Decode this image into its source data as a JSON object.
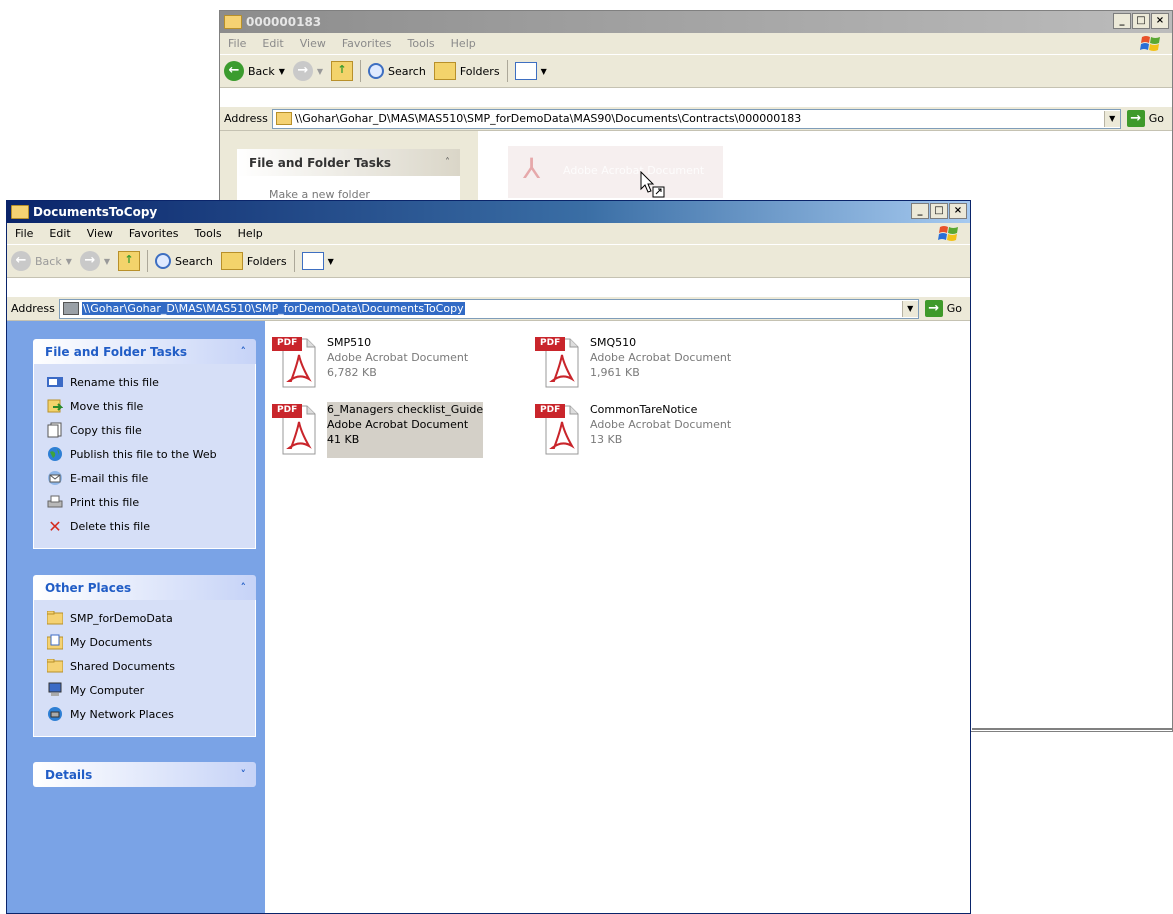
{
  "back_window": {
    "title": "000000183",
    "menu": [
      "File",
      "Edit",
      "View",
      "Favorites",
      "Tools",
      "Help"
    ],
    "toolbar": {
      "back": "Back",
      "search": "Search",
      "folders": "Folders"
    },
    "address_label": "Address",
    "address": "\\\\Gohar\\Gohar_D\\MAS\\MAS510\\SMP_forDemoData\\MAS90\\Documents\\Contracts\\000000183",
    "go": "Go",
    "task_title": "File and Folder Tasks",
    "task_first": "Make a new folder",
    "ghost_file": {
      "type": "Adobe Acrobat Document"
    }
  },
  "front_window": {
    "title": "DocumentsToCopy",
    "menu": [
      "File",
      "Edit",
      "View",
      "Favorites",
      "Tools",
      "Help"
    ],
    "toolbar": {
      "back": "Back",
      "search": "Search",
      "folders": "Folders"
    },
    "address_label": "Address",
    "address": "\\\\Gohar\\Gohar_D\\MAS\\MAS510\\SMP_forDemoData\\DocumentsToCopy",
    "go": "Go",
    "file_folder_tasks": {
      "title": "File and Folder Tasks",
      "toggle": "»",
      "items": [
        {
          "label": "Rename this file",
          "icon": "rename-icon"
        },
        {
          "label": "Move this file",
          "icon": "move-icon"
        },
        {
          "label": "Copy this file",
          "icon": "copy-icon"
        },
        {
          "label": "Publish this file to the Web",
          "icon": "publish-web-icon"
        },
        {
          "label": "E-mail this file",
          "icon": "email-icon"
        },
        {
          "label": "Print this file",
          "icon": "print-icon"
        },
        {
          "label": "Delete this file",
          "icon": "delete-icon"
        }
      ]
    },
    "other_places": {
      "title": "Other Places",
      "toggle": "»",
      "items": [
        {
          "label": "SMP_forDemoData",
          "icon": "folder-icon"
        },
        {
          "label": "My Documents",
          "icon": "my-documents-icon"
        },
        {
          "label": "Shared Documents",
          "icon": "folder-icon"
        },
        {
          "label": "My Computer",
          "icon": "my-computer-icon"
        },
        {
          "label": "My Network Places",
          "icon": "network-places-icon"
        }
      ]
    },
    "details": {
      "title": "Details",
      "toggle": "»"
    },
    "files": [
      {
        "name": "SMP510",
        "type": "Adobe Acrobat Document",
        "size": "6,782 KB",
        "selected": false
      },
      {
        "name": "SMQ510",
        "type": "Adobe Acrobat Document",
        "size": "1,961 KB",
        "selected": false
      },
      {
        "name": "6_Managers checklist_Guide",
        "type": "Adobe Acrobat Document",
        "size": "41 KB",
        "selected": true
      },
      {
        "name": "CommonTareNotice",
        "type": "Adobe Acrobat Document",
        "size": "13 KB",
        "selected": false
      }
    ],
    "pdf_badge": "PDF"
  },
  "colors": {
    "title_active": "#0a246a",
    "title_inactive": "#7a96df",
    "task_pane": "#7aa3e6",
    "pdf_red": "#c9252b"
  }
}
